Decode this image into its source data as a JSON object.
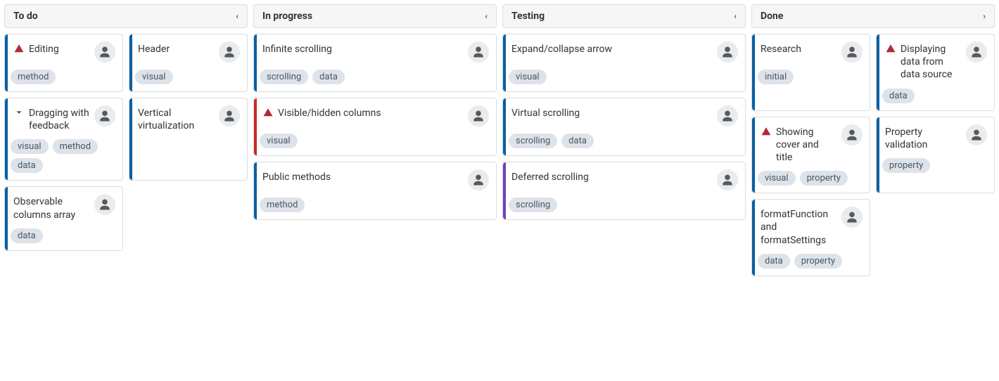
{
  "colors": {
    "stripe_default": "#0a5fa3",
    "stripe_red": "#c92a2a",
    "stripe_purple": "#6f42c1"
  },
  "chevrons": {
    "left": "‹",
    "right": "›"
  },
  "columns": [
    {
      "id": "todo",
      "title": "To do",
      "chevron": "left",
      "layout": "two",
      "cards": [
        {
          "title": "Editing",
          "tags": [
            "method"
          ],
          "stripe": "stripe_default",
          "indicator": "alert"
        },
        {
          "title": "Header",
          "tags": [
            "visual"
          ],
          "stripe": "stripe_default"
        },
        {
          "title": "Dragging with feedback",
          "tags": [
            "visual",
            "method",
            "data"
          ],
          "stripe": "stripe_default",
          "indicator": "caret"
        },
        {
          "title": "Vertical virtualization",
          "tags": [],
          "stripe": "stripe_default"
        },
        {
          "title": "Observable columns array",
          "tags": [
            "data"
          ],
          "stripe": "stripe_default"
        }
      ]
    },
    {
      "id": "inprogress",
      "title": "In progress",
      "chevron": "left",
      "layout": "one",
      "cards": [
        {
          "title": "Infinite scrolling",
          "tags": [
            "scrolling",
            "data"
          ],
          "stripe": "stripe_default"
        },
        {
          "title": "Visible/hidden columns",
          "tags": [
            "visual"
          ],
          "stripe": "stripe_red",
          "indicator": "alert"
        },
        {
          "title": "Public methods",
          "tags": [
            "method"
          ],
          "stripe": "stripe_default"
        }
      ]
    },
    {
      "id": "testing",
      "title": "Testing",
      "chevron": "left",
      "layout": "one",
      "cards": [
        {
          "title": "Expand/collapse arrow",
          "tags": [
            "visual"
          ],
          "stripe": "stripe_default"
        },
        {
          "title": "Virtual scrolling",
          "tags": [
            "scrolling",
            "data"
          ],
          "stripe": "stripe_default"
        },
        {
          "title": "Deferred scrolling",
          "tags": [
            "scrolling"
          ],
          "stripe": "stripe_purple"
        }
      ]
    },
    {
      "id": "done",
      "title": "Done",
      "chevron": "right",
      "layout": "two",
      "cards": [
        {
          "title": "Research",
          "tags": [
            "initial"
          ],
          "stripe": "stripe_default"
        },
        {
          "title": "Displaying data from data source",
          "tags": [
            "data"
          ],
          "stripe": "stripe_default",
          "indicator": "alert"
        },
        {
          "title": "Showing cover and title",
          "tags": [
            "visual",
            "property"
          ],
          "stripe": "stripe_default",
          "indicator": "alert"
        },
        {
          "title": "Property validation",
          "tags": [
            "property"
          ],
          "stripe": "stripe_default"
        },
        {
          "title": "formatFunction and formatSettings",
          "tags": [
            "data",
            "property"
          ],
          "stripe": "stripe_default"
        }
      ]
    }
  ]
}
